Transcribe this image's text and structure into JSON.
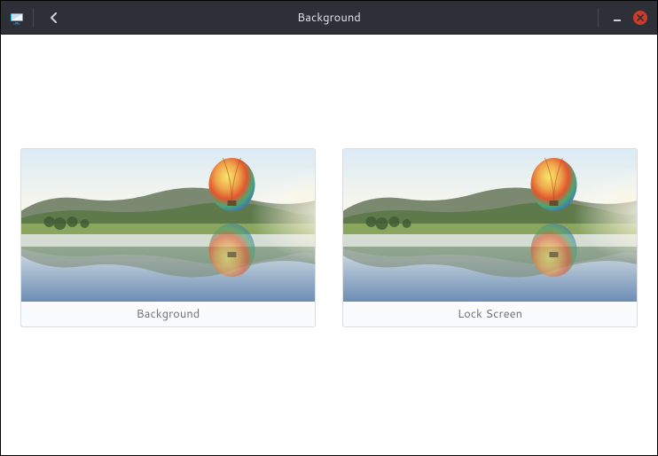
{
  "titlebar": {
    "app_icon": "monitor-icon",
    "back_icon": "chevron-left-icon",
    "title": "Background",
    "minimize_icon": "minimize-icon",
    "close_icon": "close-icon"
  },
  "panels": {
    "background": {
      "label": "Background"
    },
    "lock_screen": {
      "label": "Lock Screen"
    }
  }
}
